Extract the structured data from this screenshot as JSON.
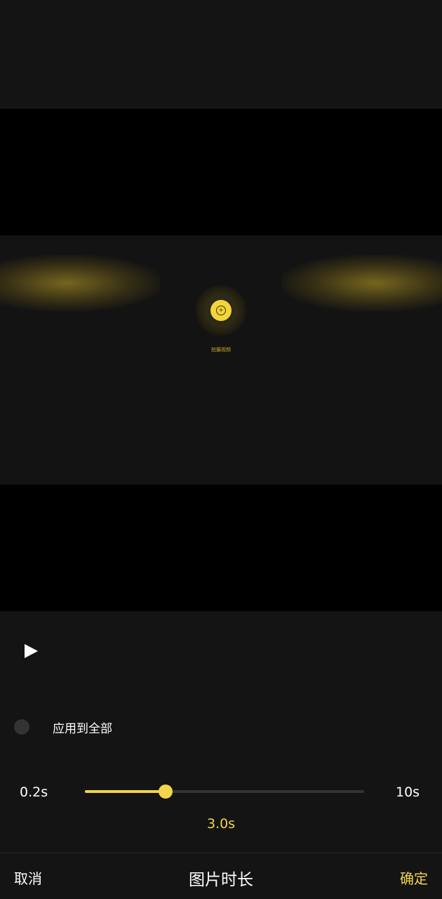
{
  "preview": {
    "record_label": "拍摄视频"
  },
  "controls": {
    "play_icon": "play-icon",
    "apply_all_label": "应用到全部",
    "apply_all_checked": false
  },
  "duration_slider": {
    "min_label": "0.2s",
    "max_label": "10s",
    "value_label": "3.0s",
    "fill_fraction": 0.29
  },
  "bottom_bar": {
    "cancel_label": "取消",
    "title": "图片时长",
    "confirm_label": "确定"
  },
  "colors": {
    "accent": "#f3d44b",
    "background": "#141414",
    "track": "#333333"
  }
}
